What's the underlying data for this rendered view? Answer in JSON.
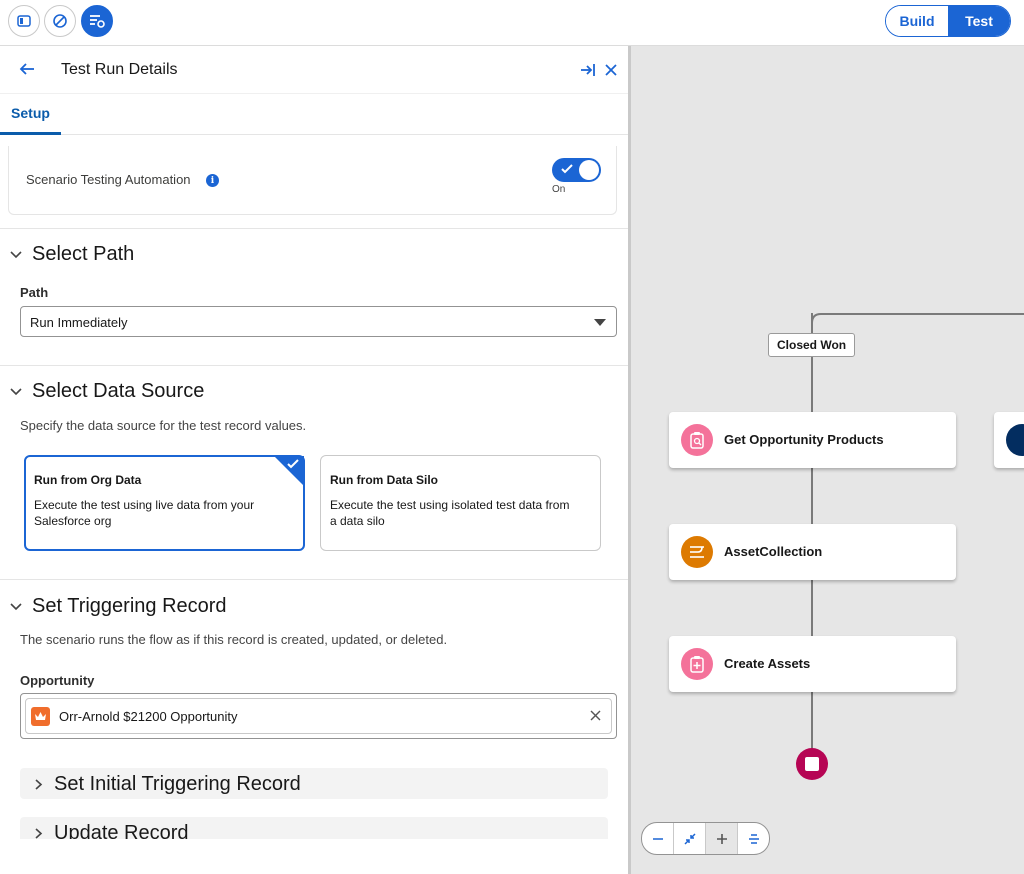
{
  "topbar": {
    "build_label": "Build",
    "test_label": "Test"
  },
  "panel": {
    "title": "Test Run Details",
    "tabs": [
      {
        "label": "Setup"
      }
    ],
    "automation": {
      "label": "Scenario Testing Automation",
      "toggle_state": "On"
    },
    "select_path": {
      "title": "Select Path",
      "path_label": "Path",
      "path_value": "Run Immediately"
    },
    "data_source": {
      "title": "Select Data Source",
      "description": "Specify the data source for the test record values.",
      "options": [
        {
          "title": "Run from Org Data",
          "description": "Execute the test using live data from your Salesforce org",
          "selected": true
        },
        {
          "title": "Run from Data Silo",
          "description": "Execute the test using isolated test data from a data silo",
          "selected": false
        }
      ]
    },
    "triggering_record": {
      "title": "Set Triggering Record",
      "description": "The scenario runs the flow as if this record is created, updated, or deleted.",
      "object_label": "Opportunity",
      "record_value": "Orr-Arnold $21200 Opportunity"
    },
    "accordions": [
      {
        "title": "Set Initial Triggering Record"
      },
      {
        "title": "Update Record"
      }
    ]
  },
  "canvas": {
    "branch_label": "Closed Won",
    "nodes": [
      {
        "label": "Get Opportunity Products",
        "icon": "get-records-icon"
      },
      {
        "label": "AssetCollection",
        "icon": "transform-icon"
      },
      {
        "label": "Create Assets",
        "icon": "create-records-icon"
      }
    ]
  },
  "colors": {
    "brand": "#1b65d4",
    "get_records": "#f4729a",
    "transform": "#dd7a01",
    "end": "#b60554"
  }
}
